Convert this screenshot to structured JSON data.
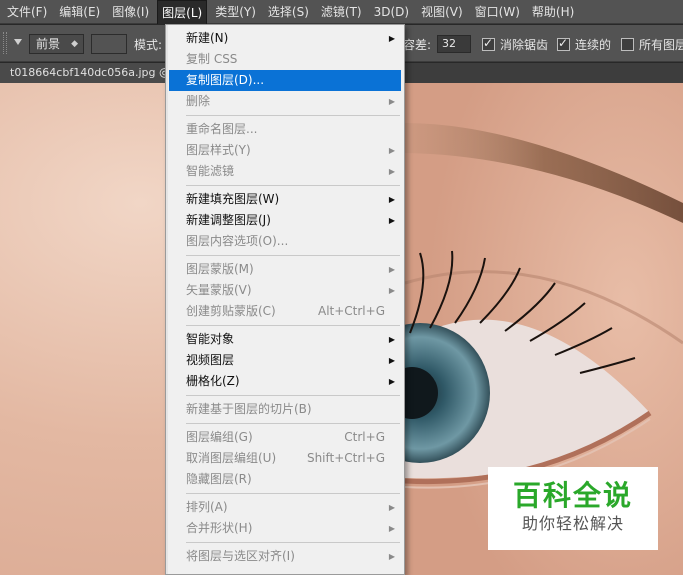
{
  "menubar": {
    "items": [
      "文件(F)",
      "编辑(E)",
      "图像(I)",
      "图层(L)",
      "类型(Y)",
      "选择(S)",
      "滤镜(T)",
      "3D(D)",
      "视图(V)",
      "窗口(W)",
      "帮助(H)"
    ],
    "active": "图层(L)"
  },
  "options": {
    "preset": "前景",
    "mode_label": "模式:",
    "tolerance_label": "容差:",
    "tolerance_value": "32",
    "antialias_label": "消除锯齿",
    "contiguous_label": "连续的",
    "all_layers_label": "所有图层",
    "antialias_checked": true,
    "contiguous_checked": true,
    "all_layers_checked": false
  },
  "document": {
    "tab_title": "t018664cbf140dc056a.jpg @"
  },
  "layer_menu": {
    "items": [
      {
        "label": "新建(N)",
        "enabled": true,
        "submenu": true
      },
      {
        "label": "复制 CSS",
        "enabled": false
      },
      {
        "label": "复制图层(D)...",
        "enabled": true,
        "highlighted": true
      },
      {
        "label": "删除",
        "enabled": false,
        "submenu": true
      },
      {
        "sep": true
      },
      {
        "label": "重命名图层...",
        "enabled": false
      },
      {
        "label": "图层样式(Y)",
        "enabled": false,
        "submenu": true
      },
      {
        "label": "智能滤镜",
        "enabled": false,
        "submenu": true
      },
      {
        "sep": true
      },
      {
        "label": "新建填充图层(W)",
        "enabled": true,
        "submenu": true
      },
      {
        "label": "新建调整图层(J)",
        "enabled": true,
        "submenu": true
      },
      {
        "label": "图层内容选项(O)...",
        "enabled": false
      },
      {
        "sep": true
      },
      {
        "label": "图层蒙版(M)",
        "enabled": false,
        "submenu": true
      },
      {
        "label": "矢量蒙版(V)",
        "enabled": false,
        "submenu": true
      },
      {
        "label": "创建剪贴蒙版(C)",
        "enabled": false,
        "shortcut": "Alt+Ctrl+G"
      },
      {
        "sep": true
      },
      {
        "label": "智能对象",
        "enabled": true,
        "submenu": true
      },
      {
        "label": "视频图层",
        "enabled": true,
        "submenu": true
      },
      {
        "label": "栅格化(Z)",
        "enabled": true,
        "submenu": true
      },
      {
        "sep": true
      },
      {
        "label": "新建基于图层的切片(B)",
        "enabled": false
      },
      {
        "sep": true
      },
      {
        "label": "图层编组(G)",
        "enabled": false,
        "shortcut": "Ctrl+G"
      },
      {
        "label": "取消图层编组(U)",
        "enabled": false,
        "shortcut": "Shift+Ctrl+G"
      },
      {
        "label": "隐藏图层(R)",
        "enabled": false
      },
      {
        "sep": true
      },
      {
        "label": "排列(A)",
        "enabled": false,
        "submenu": true
      },
      {
        "label": "合并形状(H)",
        "enabled": false,
        "submenu": true
      },
      {
        "sep": true
      },
      {
        "label": "将图层与选区对齐(I)",
        "enabled": false,
        "submenu": true
      }
    ]
  },
  "watermark": {
    "title": "百科全说",
    "subtitle": "助你轻松解决"
  },
  "colors": {
    "menu_highlight": "#0a72d6",
    "watermark_green": "#2aa82a",
    "ui_gray": "#535353"
  }
}
